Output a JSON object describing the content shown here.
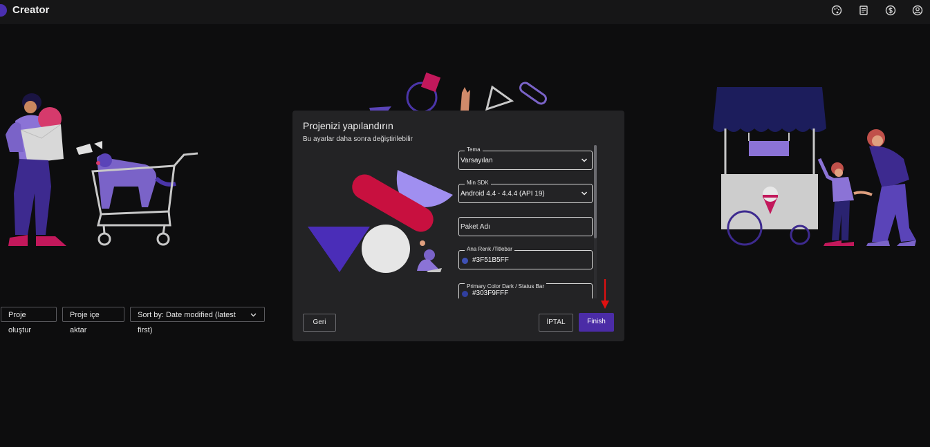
{
  "app": {
    "title": "Creator",
    "icons": [
      "palette-icon",
      "docs-icon",
      "dollar-icon",
      "account-icon"
    ]
  },
  "home": {
    "create_project_label": "Proje oluştur",
    "import_project_label": "Proje içe aktar",
    "sort_label": "Sort by: Date modified (latest first)"
  },
  "dialog": {
    "title": "Projenizi yapılandırın",
    "subtitle": "Bu ayarlar daha sonra değiştirilebilir",
    "fields": {
      "theme": {
        "label": "Tema",
        "value": "Varsayılan"
      },
      "min_sdk": {
        "label": "Min SDK",
        "value": "Android 4.4 - 4.4.4 (API 19)"
      },
      "package_name": {
        "placeholder": "Paket Adı"
      },
      "primary_color": {
        "label": "Ana Renk /Titlebar",
        "value": "#3F51B5FF",
        "color": "#3F51B5"
      },
      "primary_dark": {
        "label": "Primary Color Dark / Status Bar",
        "value": "#303F9FFF",
        "color": "#303F9F"
      }
    },
    "back_label": "Geri",
    "cancel_label": "İPTAL",
    "finish_label": "Finish"
  },
  "colors": {
    "accent": "#4b2ca6",
    "background": "#0d0d0e",
    "dialog": "#232325",
    "annotation_arrow": "#e01010"
  }
}
